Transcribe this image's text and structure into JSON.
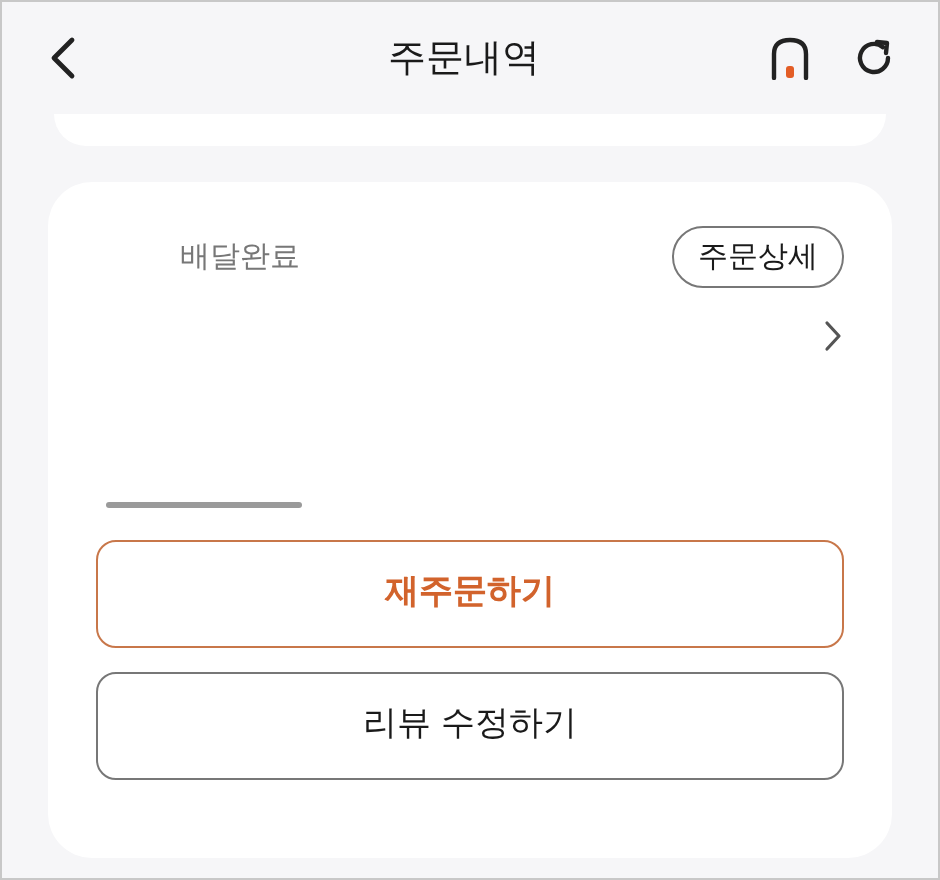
{
  "header": {
    "title": "주문내역"
  },
  "order": {
    "status": "배달완료",
    "detail_button": "주문상세"
  },
  "buttons": [
    {
      "label": "재주문하기",
      "kind": "primary"
    },
    {
      "label": "리뷰 수정하기",
      "kind": "secondary"
    }
  ]
}
